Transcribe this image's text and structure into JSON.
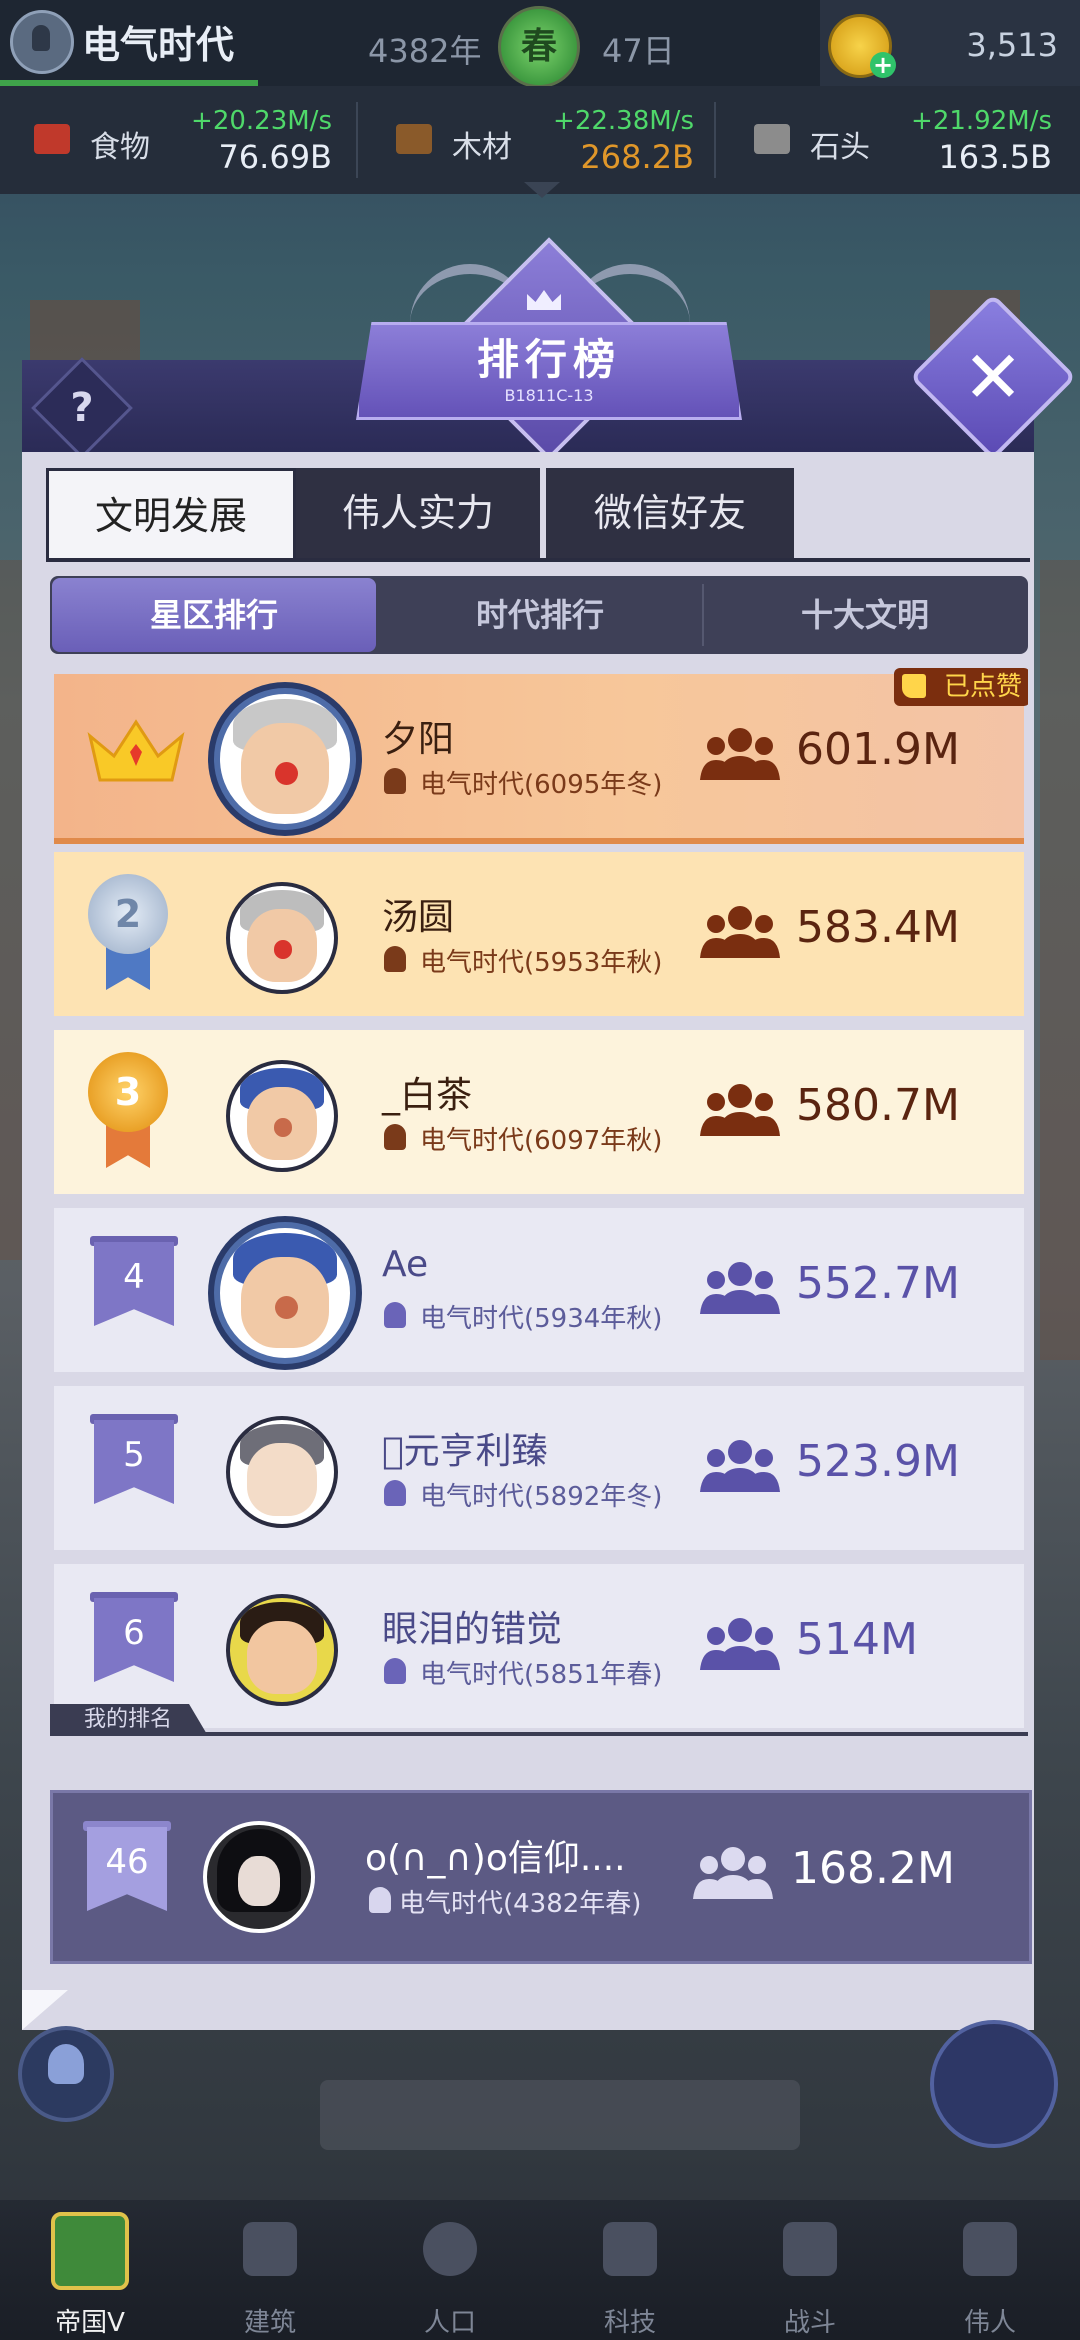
{
  "topbar": {
    "era_name": "电气时代",
    "year": "4382年",
    "season": "春",
    "day": "47日",
    "gold": "3,513"
  },
  "resources": [
    {
      "name": "食物",
      "rate": "+20.23M/s",
      "value": "76.69B",
      "value_color": "#e8eef6",
      "icon_color": "#c0392b"
    },
    {
      "name": "木材",
      "rate": "+22.38M/s",
      "value": "268.2B",
      "value_color": "#e0972a",
      "icon_color": "#8a5a2a"
    },
    {
      "name": "石头",
      "rate": "+21.92M/s",
      "value": "163.5B",
      "value_color": "#e8eef6",
      "icon_color": "#8c8c8c"
    }
  ],
  "panel": {
    "title": "排行榜",
    "code": "B1811C-13",
    "help": "?",
    "close": "✕"
  },
  "main_tabs": [
    {
      "label": "文明发展",
      "active": true
    },
    {
      "label": "伟人实力",
      "active": false
    },
    {
      "label": "微信好友",
      "active": false
    }
  ],
  "sub_tabs": [
    {
      "label": "星区排行",
      "active": true
    },
    {
      "label": "时代排行",
      "active": false
    },
    {
      "label": "十大文明",
      "active": false
    }
  ],
  "liked_label": "已点赞",
  "rankings": [
    {
      "rank": "1",
      "name": "夕阳",
      "era": "电气时代(6095年冬)",
      "population": "601.9M"
    },
    {
      "rank": "2",
      "name": "汤圆",
      "era": "电气时代(5953年秋)",
      "population": "583.4M"
    },
    {
      "rank": "3",
      "name": "_白茶",
      "era": "电气时代(6097年秋)",
      "population": "580.7M"
    },
    {
      "rank": "4",
      "name": "Ae",
      "era": "电气时代(5934年秋)",
      "population": "552.7M"
    },
    {
      "rank": "5",
      "name": "\u0000元亨利臻",
      "era": "电气时代(5892年冬)",
      "population": "523.9M"
    },
    {
      "rank": "6",
      "name": "眼泪的错觉",
      "era": "电气时代(5851年春)",
      "population": "514M"
    }
  ],
  "my_rank": {
    "label": "我的排名",
    "rank": "46",
    "name": "o(∩_∩)o信仰....",
    "era": "电气时代(4382年春)",
    "population": "168.2M"
  },
  "nav": [
    {
      "label": "帝国V",
      "active": true
    },
    {
      "label": "建筑",
      "active": false
    },
    {
      "label": "人口",
      "active": false
    },
    {
      "label": "科技",
      "active": false
    },
    {
      "label": "战斗",
      "active": false
    },
    {
      "label": "伟人",
      "active": false
    }
  ]
}
